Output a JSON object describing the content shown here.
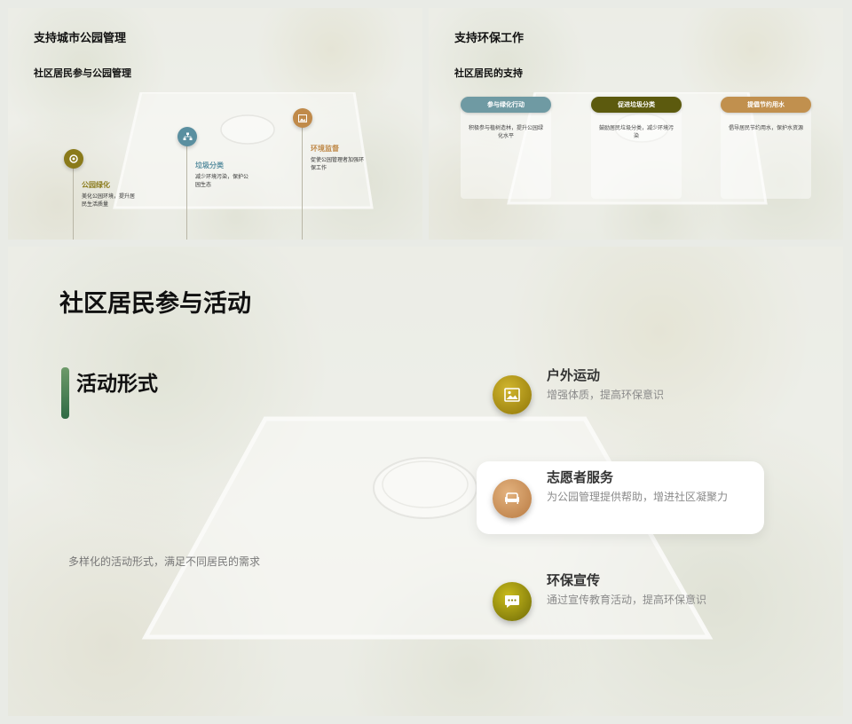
{
  "slide1": {
    "title": "支持城市公园管理",
    "subtitle": "社区居民参与公园管理",
    "nodes": [
      {
        "label": "公园绿化",
        "desc_line1": "美化公园环境，提升居",
        "desc_line2": "民生活质量",
        "color": "#8a7a1a",
        "icon": "target-icon"
      },
      {
        "label": "垃圾分类",
        "desc_line1": "减少环境污染，保护公",
        "desc_line2": "园生态",
        "color": "#5a8fa0",
        "icon": "sitemap-icon"
      },
      {
        "label": "环境监督",
        "desc_line1": "促使公园管理者加强环",
        "desc_line2": "保工作",
        "color": "#c08a4a",
        "icon": "image-icon"
      }
    ]
  },
  "slide2": {
    "title": "支持环保工作",
    "subtitle": "社区居民的支持",
    "cards": [
      {
        "label": "参与绿化行动",
        "desc_line1": "积极参与植树造林，提升公园绿",
        "desc_line2": "化水平",
        "color": "#6f9aa3"
      },
      {
        "label": "促进垃圾分类",
        "desc_line1": "鼓励居民垃圾分类，减少环境污",
        "desc_line2": "染",
        "color": "#5c5a0e"
      },
      {
        "label": "提倡节约用水",
        "desc_line1": "倡导居民节约用水，保护水资源",
        "desc_line2": "",
        "color": "#c1904e"
      }
    ]
  },
  "slide3": {
    "title": "社区居民参与活动",
    "section_title": "活动形式",
    "side_text": "多样化的活动形式，满足不同居民的需求",
    "items": [
      {
        "title": "户外运动",
        "desc": "增强体质，提高环保意识",
        "icon": "image-icon",
        "color": "#a8901a"
      },
      {
        "title": "志愿者服务",
        "desc": "为公园管理提供帮助，增进社区凝聚力",
        "icon": "sofa-icon",
        "color": "#c9925a"
      },
      {
        "title": "环保宣传",
        "desc": "通过宣传教育活动，提高环保意识",
        "icon": "chat-icon",
        "color": "#8f8a10"
      }
    ]
  }
}
